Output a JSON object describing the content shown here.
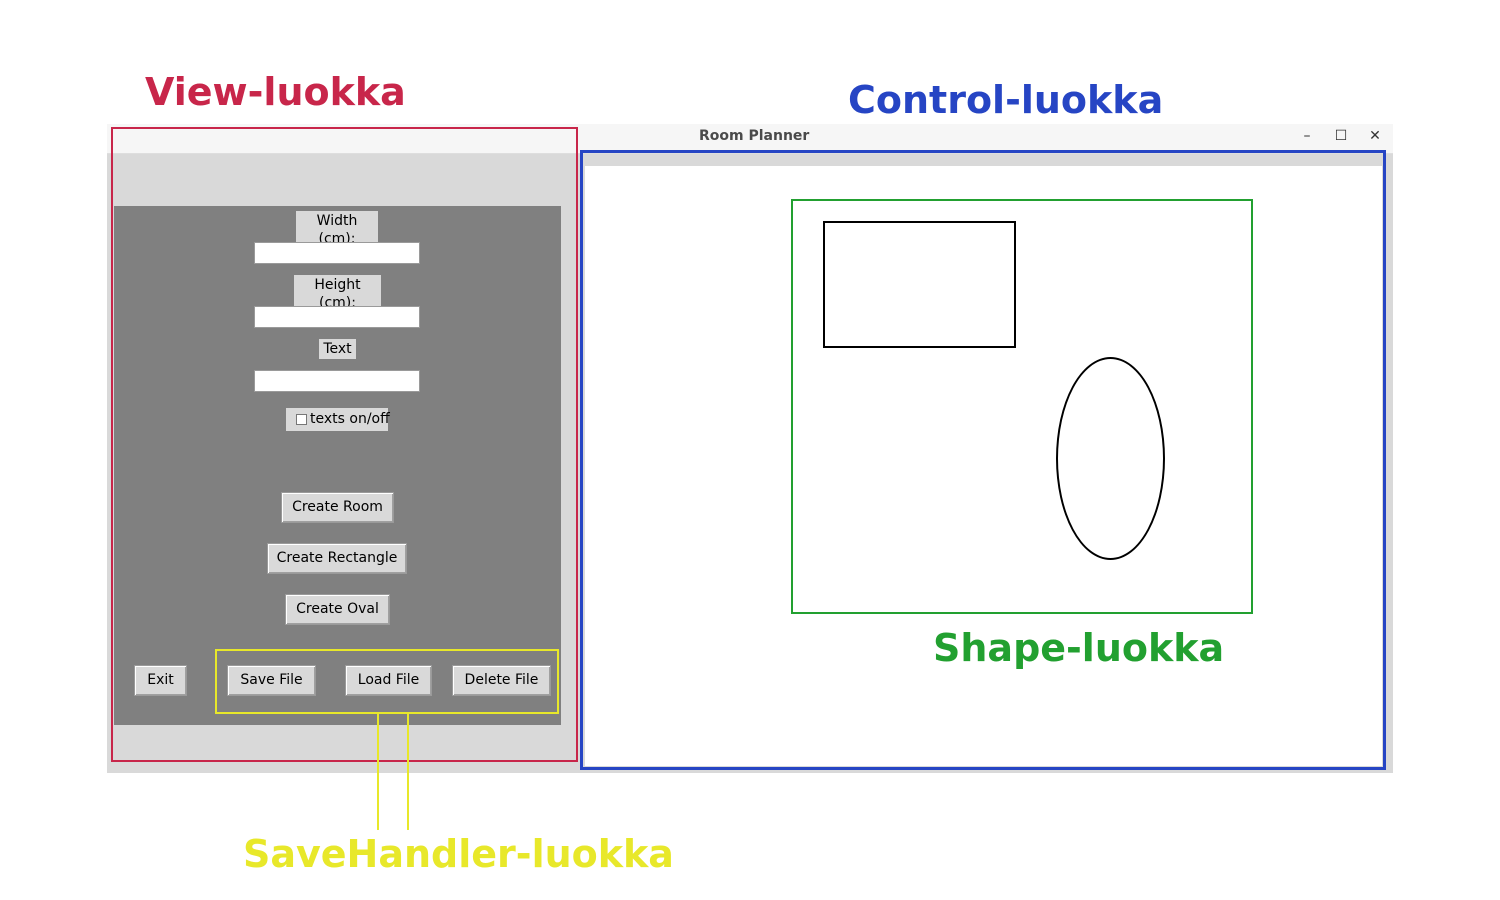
{
  "annotations": {
    "view": "View-luokka",
    "control": "Control-luokka",
    "shape": "Shape-luokka",
    "savehandler": "SaveHandler-luokka"
  },
  "window": {
    "title": "Room Planner",
    "minimize": "–",
    "maximize": "☐",
    "close": "✕"
  },
  "form": {
    "width_label": "Width (cm):",
    "width_value": "",
    "height_label": "Height (cm):",
    "height_value": "",
    "text_label": "Text",
    "text_value": "",
    "texts_toggle_label": "texts on/off",
    "texts_toggle_checked": false
  },
  "buttons": {
    "create_room": "Create Room",
    "create_rectangle": "Create Rectangle",
    "create_oval": "Create Oval",
    "exit": "Exit",
    "save_file": "Save File",
    "load_file": "Load File",
    "delete_file": "Delete File"
  },
  "colors": {
    "view_annotation": "#c8264a",
    "control_annotation": "#2645c4",
    "shape_annotation": "#22a030",
    "savehandler_annotation": "#e8e82a",
    "panel_background": "#808080",
    "window_background": "#d9d9d9"
  },
  "canvas_shapes": [
    {
      "type": "room",
      "outline": "#22a030"
    },
    {
      "type": "rectangle",
      "outline": "#000000"
    },
    {
      "type": "oval",
      "outline": "#000000"
    }
  ]
}
